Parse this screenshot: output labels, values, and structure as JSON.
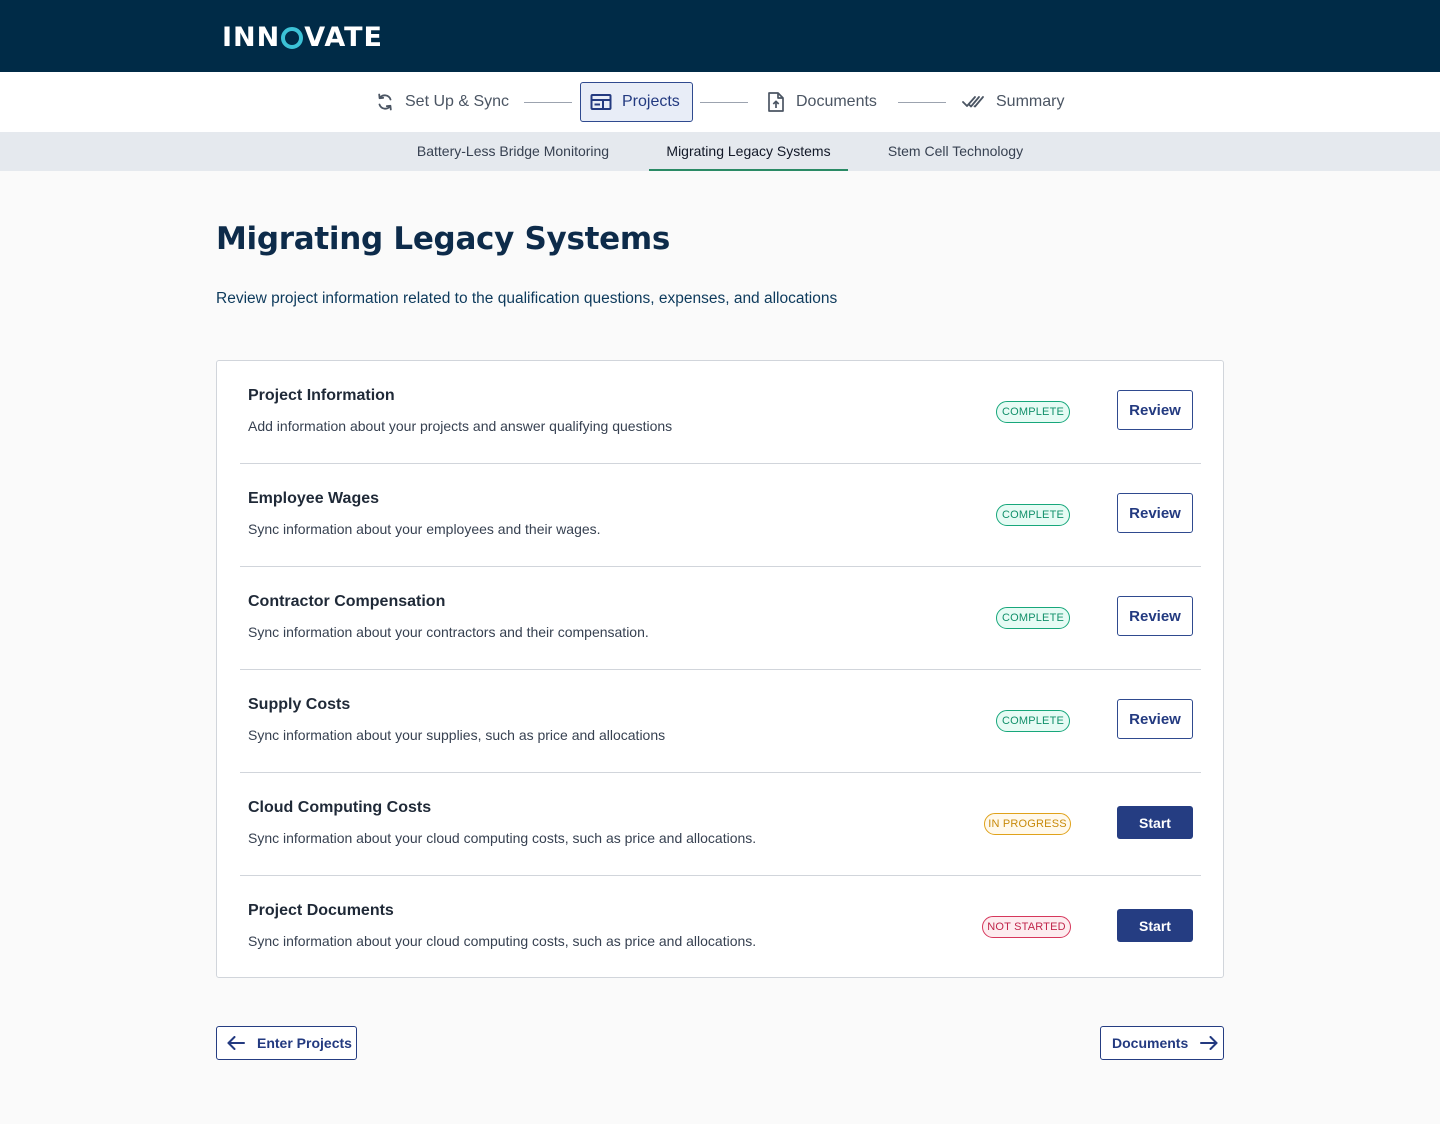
{
  "brand": {
    "logo_before": "INN",
    "logo_after": "VATE"
  },
  "stepper": {
    "steps": [
      {
        "label": "Set Up & Sync",
        "icon": "sync-icon",
        "active": false
      },
      {
        "label": "Projects",
        "icon": "projects-icon",
        "active": true
      },
      {
        "label": "Documents",
        "icon": "document-upload-icon",
        "active": false
      },
      {
        "label": "Summary",
        "icon": "double-check-icon",
        "active": false
      }
    ]
  },
  "project_tabs": [
    {
      "label": "Battery-Less Bridge Monitoring",
      "active": false
    },
    {
      "label": "Migrating Legacy Systems",
      "active": true
    },
    {
      "label": "Stem Cell Technology",
      "active": false
    }
  ],
  "page": {
    "title": "Migrating Legacy Systems",
    "subtitle": "Review project information related to the qualification questions, expenses, and allocations"
  },
  "sections": [
    {
      "title": "Project Information",
      "description": "Add information about your projects and answer qualifying questions",
      "status": "COMPLETE",
      "action": "Review"
    },
    {
      "title": "Employee Wages",
      "description": "Sync information about your employees and their wages.",
      "status": "COMPLETE",
      "action": "Review"
    },
    {
      "title": "Contractor Compensation",
      "description": "Sync information about your contractors and their compensation.",
      "status": "COMPLETE",
      "action": "Review"
    },
    {
      "title": "Supply Costs",
      "description": "Sync information about your supplies, such as price and allocations",
      "status": "COMPLETE",
      "action": "Review"
    },
    {
      "title": "Cloud Computing Costs",
      "description": "Sync information about your cloud computing costs, such as price and allocations.",
      "status": "IN PROGRESS",
      "action": "Start"
    },
    {
      "title": "Project Documents",
      "description": "Sync information about your cloud computing costs, such as price and allocations.",
      "status": "NOT STARTED",
      "action": "Start"
    }
  ],
  "footer_nav": {
    "back_label": "Enter Projects",
    "next_label": "Documents"
  },
  "colors": {
    "header_bg": "#002b47",
    "logo_accent": "#3cc2d6",
    "primary": "#253d82",
    "complete": "#17a77b",
    "in_progress": "#e0a21a",
    "not_started": "#d6375c"
  }
}
